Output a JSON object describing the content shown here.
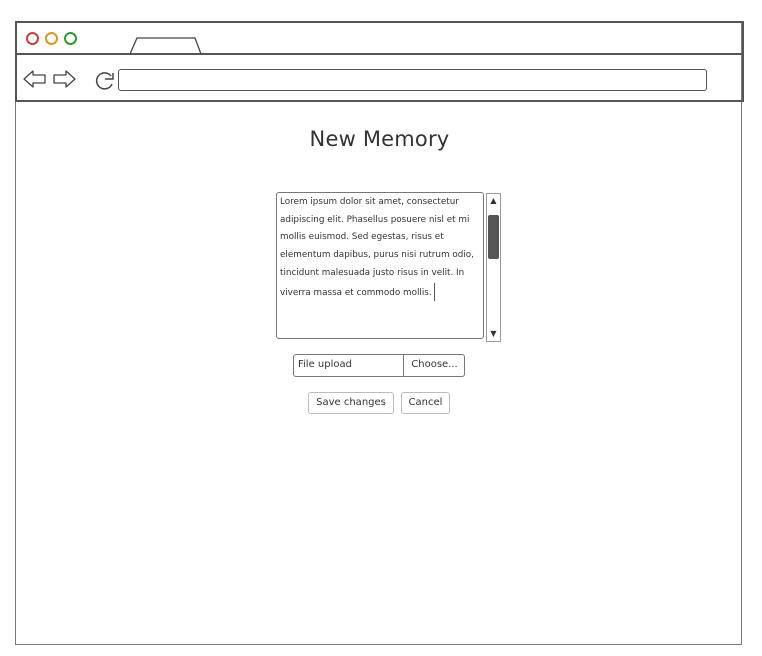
{
  "page": {
    "title": "New Memory"
  },
  "memory_form": {
    "body_text": "Lorem ipsum dolor sit amet, consectetur adipiscing elit. Phasellus posuere nisl et mi mollis euismod. Sed egestas, risus et elementum dapibus, purus nisi rutrum odio, tincidunt malesuada justo risus in velit. In viverra massa et commodo mollis.",
    "file_upload_label": "File upload",
    "choose_label": "Choose...",
    "save_label": "Save changes",
    "cancel_label": "Cancel"
  },
  "icons": {
    "back": "arrow-left-icon",
    "forward": "arrow-right-icon",
    "reload": "reload-icon",
    "scroll_up": "triangle-up-icon",
    "scroll_down": "triangle-down-icon"
  },
  "colors": {
    "close": "#c0443c",
    "minimize": "#d49b21",
    "maximize": "#2f9a2f",
    "scroll_thumb": "#555555"
  }
}
